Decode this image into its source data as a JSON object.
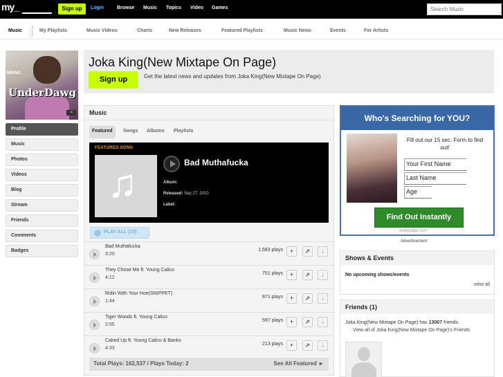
{
  "topbar": {
    "logo": "my_",
    "signup": "Sign up",
    "login": "Login",
    "nav": [
      "Browse",
      "Music",
      "Topics",
      "Video",
      "Games"
    ],
    "search_placeholder": "Search Music"
  },
  "subnav": [
    "Music",
    "My Playlists",
    "Music Videos",
    "Charts",
    "New Releases",
    "Featured Playlists",
    "Music News",
    "Events",
    "For Artists"
  ],
  "profile_photo": {
    "brand": "MKING",
    "title": "UnderDawg",
    "sticker": "dl"
  },
  "sidebar": [
    "Profile",
    "Music",
    "Photos",
    "Videos",
    "Blog",
    "Stream",
    "Friends",
    "Comments",
    "Badges"
  ],
  "header": {
    "artist": "Joka King(New Mixtape On Page)",
    "signup": "Sign up",
    "text": "Get the latest news and updates from Joka King(New Mixtape On Page)"
  },
  "music": {
    "title": "Music",
    "tabs": [
      "Featured",
      "Songs",
      "Albums",
      "Playlists"
    ],
    "featured": {
      "label": "FEATURED SONG",
      "name": "Bad Muthafucka",
      "album_label": "Album:",
      "album": "",
      "released_label": "Released:",
      "released": "Sep 27. 2010",
      "label_label": "Label:",
      "label_value": ""
    },
    "play_all": "PLAY ALL (10)",
    "tracks": [
      {
        "name": "Bad Muthafucka",
        "duration": "3:20",
        "plays": "1,583 plays"
      },
      {
        "name": "They Chose Me ft. Young Calico",
        "duration": "4:12",
        "plays": "751 plays"
      },
      {
        "name": "Ridin With Your Hoe(SNIPPET)",
        "duration": "1:44",
        "plays": "871 plays"
      },
      {
        "name": "Tiger Woods ft. Young Calico",
        "duration": "2:55",
        "plays": "597 plays"
      },
      {
        "name": "Caked Up ft. Young Calico & Banks",
        "duration": "4:33",
        "plays": "213 plays"
      }
    ],
    "footer": "Total Plays: 162,537 / Plays Today: 2",
    "see_all": "See All Featured ►"
  },
  "ad": {
    "headline": "Who's Searching for YOU?",
    "text": "Fill out our 15 sec. Form to find out!",
    "fields": [
      "Your First Name",
      "Last Name",
      "Age"
    ],
    "button": "Find Out Instantly",
    "footer": "webpyapp.com",
    "label": "Advertisement"
  },
  "shows": {
    "title": "Shows & Events",
    "text": "No upcoming shows/events",
    "view_all": "view all"
  },
  "friends": {
    "title": "Friends (1)",
    "text_prefix": "Joka King(New Mixtape On Page) has",
    "count": "13067",
    "text_suffix": "friends.",
    "link": "View all of Joka King(New Mixtape On Page)'s Friends"
  }
}
